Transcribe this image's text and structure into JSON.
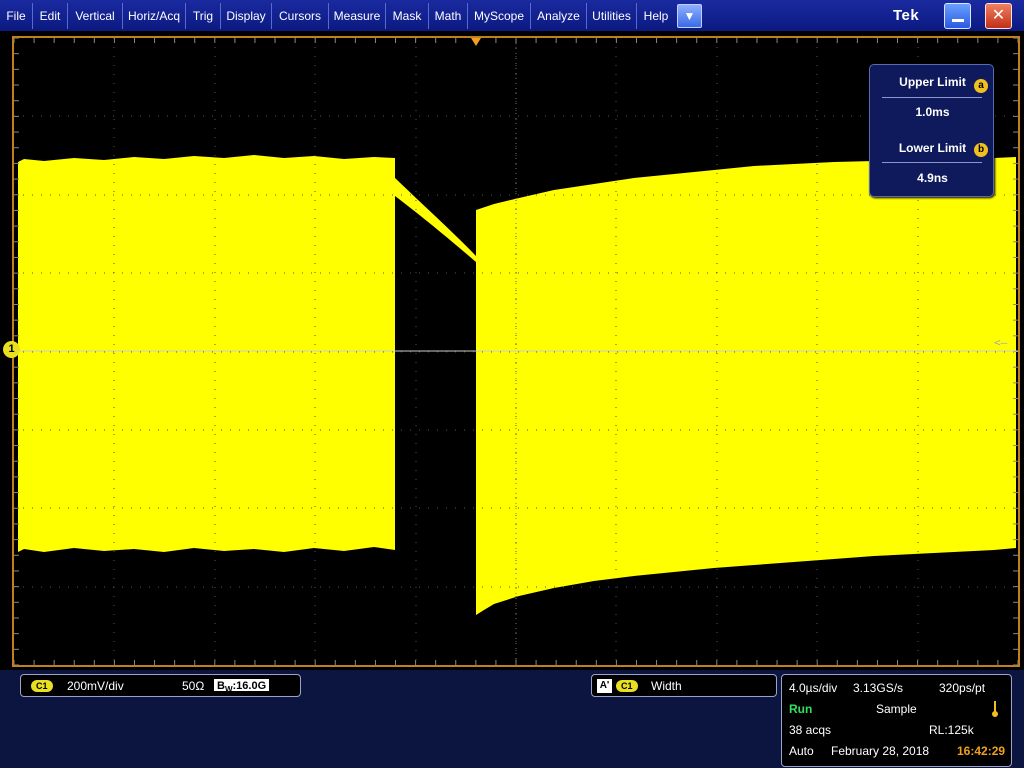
{
  "menu": {
    "items": [
      {
        "id": "file",
        "label": "File"
      },
      {
        "id": "edit",
        "label": "Edit"
      },
      {
        "id": "vertical",
        "label": "Vertical"
      },
      {
        "id": "horiz-acq",
        "label": "Horiz/Acq"
      },
      {
        "id": "trig",
        "label": "Trig"
      },
      {
        "id": "display",
        "label": "Display"
      },
      {
        "id": "cursors",
        "label": "Cursors"
      },
      {
        "id": "measure",
        "label": "Measure"
      },
      {
        "id": "mask",
        "label": "Mask"
      },
      {
        "id": "math",
        "label": "Math"
      },
      {
        "id": "myscope",
        "label": "MyScope"
      },
      {
        "id": "analyze",
        "label": "Analyze"
      },
      {
        "id": "utilities",
        "label": "Utilities"
      },
      {
        "id": "help",
        "label": "Help"
      }
    ],
    "dropdown_icon": "chevron-down-icon",
    "logo": "Tek",
    "minimize_icon": "minimize-icon",
    "close_icon": "close-icon"
  },
  "colors": {
    "waveform": "#ffff00",
    "graticule_border": "#c08020",
    "menubar": "#0b1a80",
    "run_status": "#30e060",
    "clock": "#f0a020",
    "channel_badge": "#e8e020"
  },
  "scope": {
    "channel_marker": "1",
    "grid_cols": 10,
    "grid_rows": 8
  },
  "limits": {
    "upper_label": "Upper Limit",
    "upper_badge": "a",
    "upper_value": "1.0ms",
    "lower_label": "Lower Limit",
    "lower_badge": "b",
    "lower_value": "4.9ns"
  },
  "channel": {
    "badge": "C1",
    "scale": "200mV/div",
    "impedance": "50Ω",
    "bw_prefix": "B",
    "bw_sub": "W",
    "bw_value": ":16.0G"
  },
  "measurement": {
    "ref_badge": "A'",
    "channel_badge": "C1",
    "label": "Width"
  },
  "acquisition": {
    "horiz_scale": "4.0µs/div",
    "sample_rate": "3.13GS/s",
    "resolution": "320ps/pt",
    "state": "Run",
    "mode": "Sample",
    "acqs": "38 acqs",
    "record_length": "RL:125k",
    "trigger_mode": "Auto",
    "date": "February 28, 2018",
    "time": "16:42:29"
  }
}
